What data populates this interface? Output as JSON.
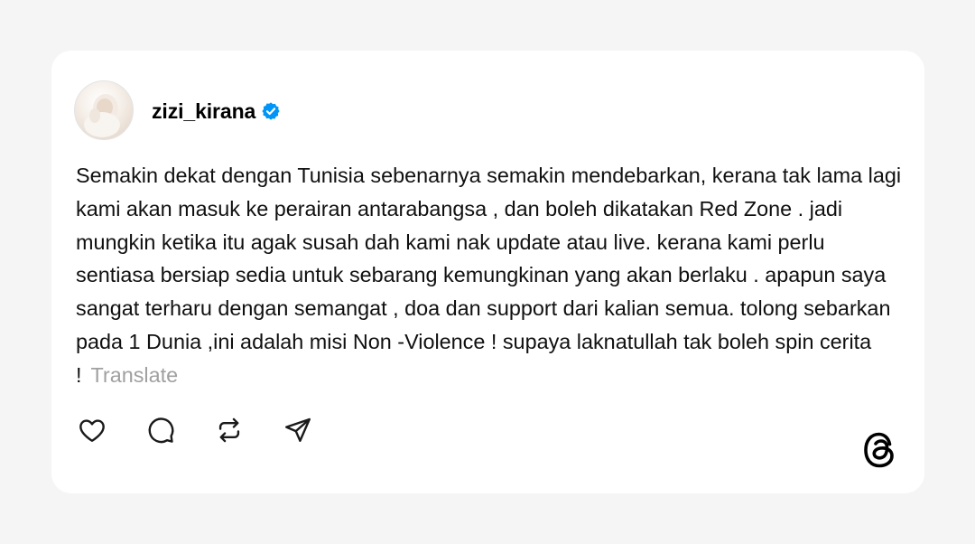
{
  "post": {
    "username": "zizi_kirana",
    "text": "Semakin dekat dengan Tunisia sebenarnya semakin mendebarkan, kerana tak lama lagi kami akan masuk ke perairan antarabangsa , dan boleh dikatakan Red Zone . jadi mungkin ketika itu agak susah dah kami nak update atau live. kerana kami perlu sentiasa bersiap sedia untuk sebarang kemungkinan yang akan berlaku . apapun saya sangat terharu dengan semangat , doa dan support dari kalian semua. tolong sebarkan pada 1 Dunia ,ini adalah misi Non -Violence ! supaya laknatullah tak boleh spin cerita !",
    "translate_label": "Translate"
  },
  "icons": {
    "verified": "verified-badge-icon",
    "like": "heart-icon",
    "comment": "comment-icon",
    "repost": "repost-icon",
    "share": "send-icon",
    "brand": "threads-logo-icon"
  },
  "colors": {
    "page_background": "#f5f5f5",
    "card_background": "#ffffff",
    "verified_blue": "#0095f6",
    "text_primary": "#101010",
    "text_muted": "#a0a0a0"
  }
}
